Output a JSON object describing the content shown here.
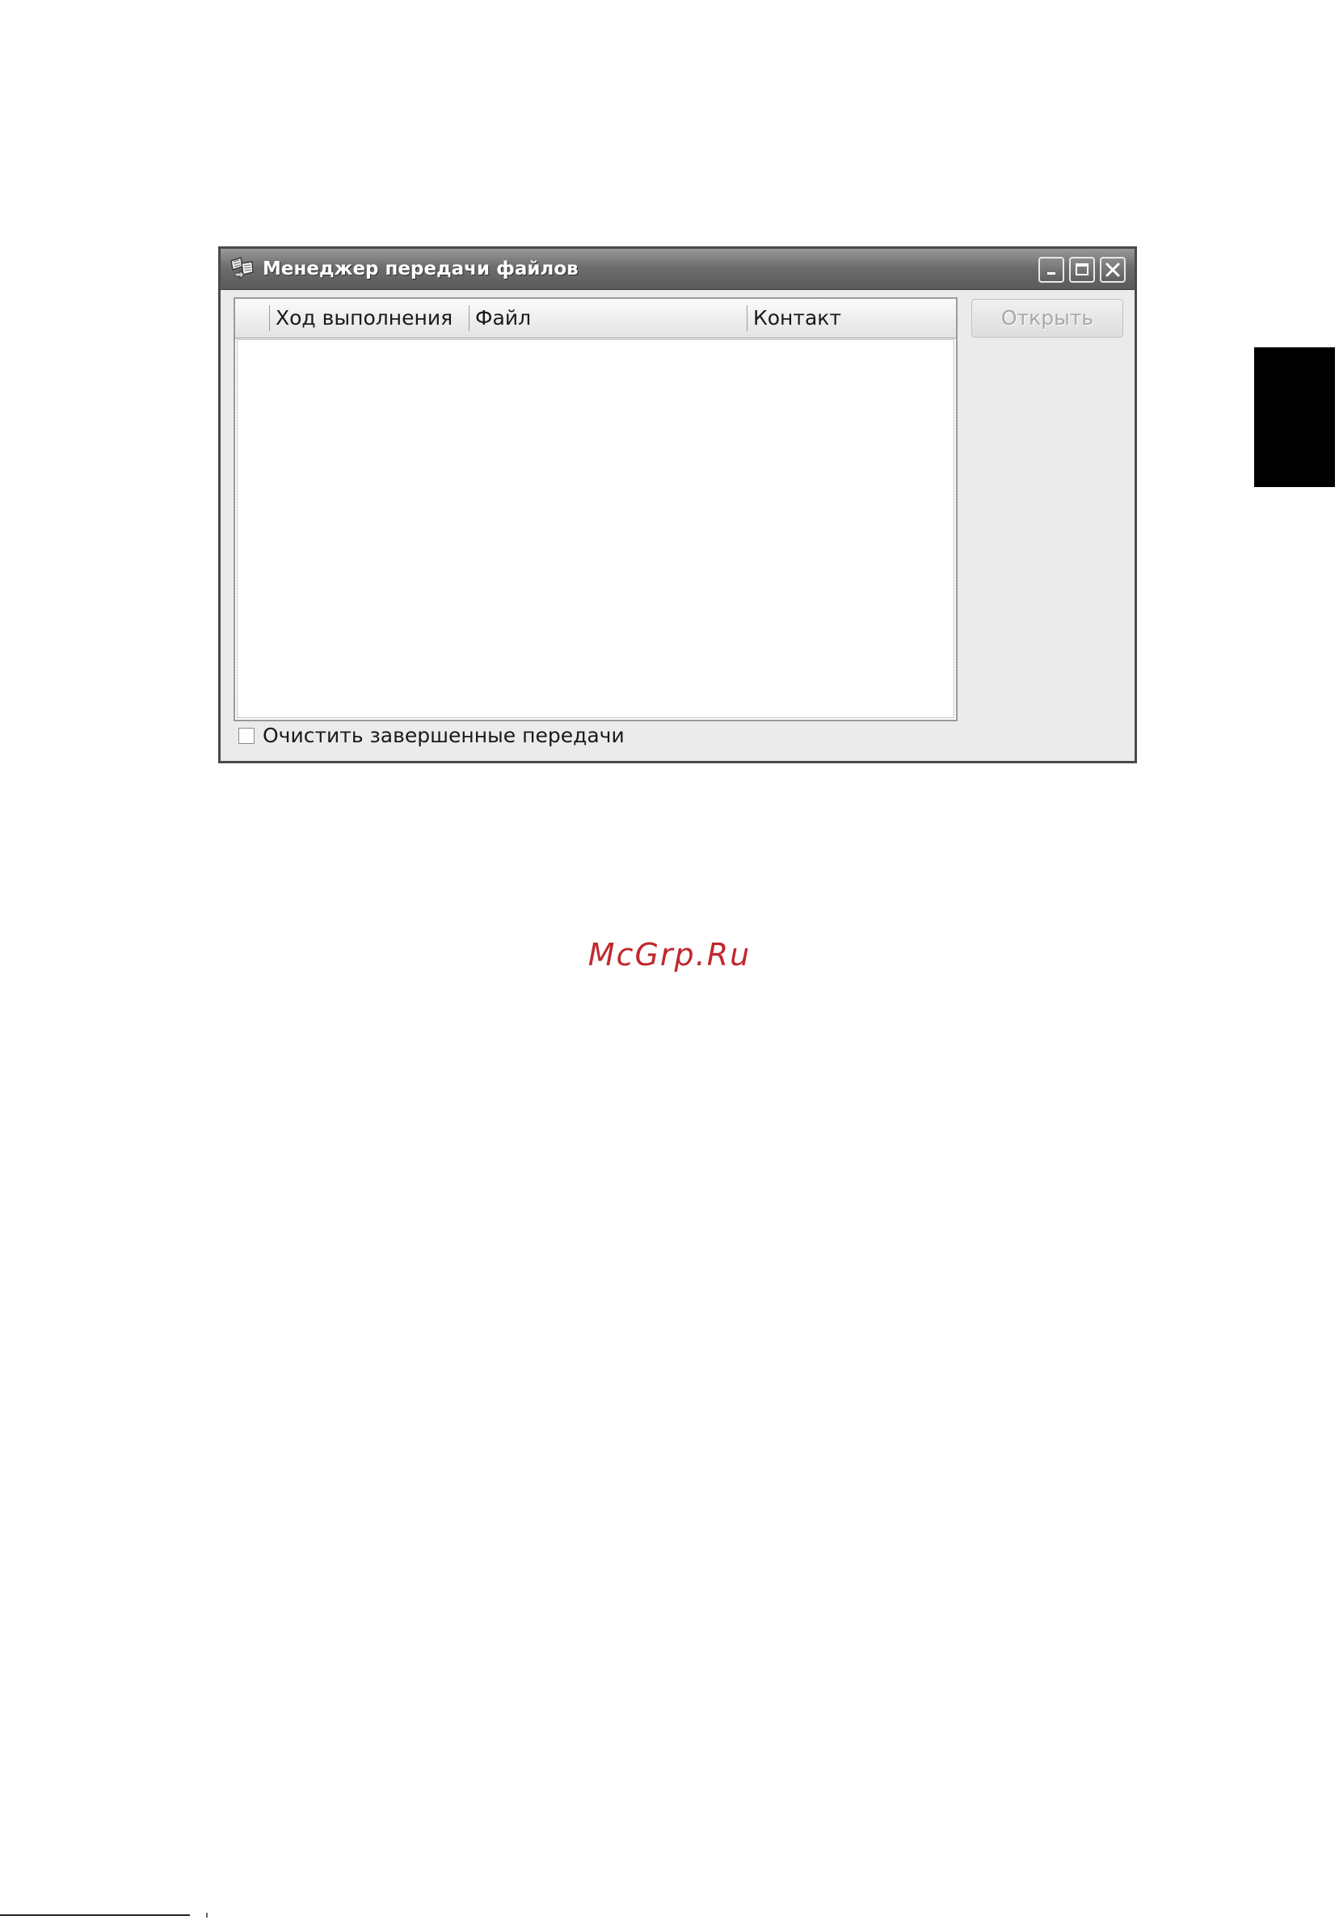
{
  "window": {
    "title": "Менеджер передачи файлов",
    "app_icon": "file-transfer-icon",
    "controls": {
      "minimize_icon": "minimize-icon",
      "maximize_icon": "maximize-icon",
      "close_icon": "close-icon"
    }
  },
  "transfer_list": {
    "columns": [
      "",
      "Ход выполнения",
      "Файл",
      "Контакт"
    ],
    "rows": []
  },
  "buttons": {
    "open_label": "Открыть",
    "open_enabled": false
  },
  "options": {
    "clear_completed_label": "Очистить завершенные передачи",
    "clear_completed_checked": false
  },
  "watermark": "McGrp.Ru",
  "colors": {
    "titlebar": "#6d6d6d",
    "window_bg": "#ebebeb",
    "watermark": "#c0282d",
    "side_tab": "#000000"
  }
}
